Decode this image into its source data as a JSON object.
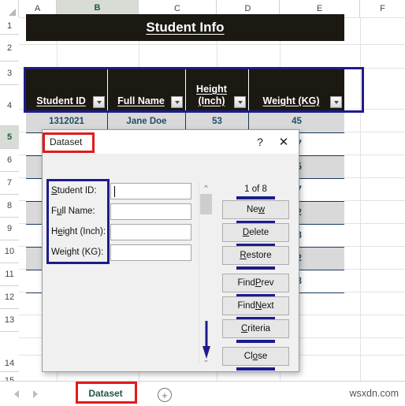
{
  "spreadsheet": {
    "column_headers": [
      "A",
      "B",
      "C",
      "D",
      "E",
      "F"
    ],
    "selected_column": "B",
    "row_headers": [
      "1",
      "2",
      "3",
      "4",
      "5",
      "6",
      "7",
      "8",
      "9",
      "10",
      "11",
      "12",
      "13",
      "14",
      "15"
    ],
    "selected_row": "5",
    "title_banner": "Student Info",
    "table_headers": [
      "Student ID",
      "Full Name",
      "Height (Inch)",
      "Weight (KG)"
    ],
    "filter_icon": "chevron-down-icon",
    "rows": [
      {
        "student_id": "1312021",
        "full_name": "Jane Doe",
        "height": "53",
        "weight": "45"
      },
      {
        "student_id": "",
        "full_name": "",
        "height": "",
        "weight": "47"
      },
      {
        "student_id": "",
        "full_name": "",
        "height": "",
        "weight": "65"
      },
      {
        "student_id": "",
        "full_name": "",
        "height": "",
        "weight": "67"
      },
      {
        "student_id": "",
        "full_name": "",
        "height": "",
        "weight": "52"
      },
      {
        "student_id": "",
        "full_name": "",
        "height": "",
        "weight": "58"
      },
      {
        "student_id": "",
        "full_name": "",
        "height": "",
        "weight": "72"
      },
      {
        "student_id": "",
        "full_name": "",
        "height": "",
        "weight": "58"
      }
    ]
  },
  "dialog": {
    "title": "Dataset",
    "help_label": "?",
    "close_label": "✕",
    "record_indicator": "1 of 8",
    "fields": [
      {
        "label_pre": "",
        "label_key": "S",
        "label_post": "tudent ID:",
        "value": "",
        "focused": true
      },
      {
        "label_pre": "F",
        "label_key": "u",
        "label_post": "ll Name:",
        "value": "",
        "focused": false
      },
      {
        "label_pre": "H",
        "label_key": "e",
        "label_post": "ight (Inch):",
        "value": "",
        "focused": false
      },
      {
        "label_pre": "Wei",
        "label_key": "g",
        "label_post": "ht (KG):",
        "value": "",
        "focused": false
      }
    ],
    "buttons": [
      {
        "pre": "Ne",
        "key": "w",
        "post": ""
      },
      {
        "pre": "",
        "key": "D",
        "post": "elete"
      },
      {
        "pre": "",
        "key": "R",
        "post": "estore"
      },
      {
        "pre": "Find ",
        "key": "P",
        "post": "rev"
      },
      {
        "pre": "Find ",
        "key": "N",
        "post": "ext"
      },
      {
        "pre": "",
        "key": "C",
        "post": "riteria"
      },
      {
        "pre": "Cl",
        "key": "o",
        "post": "se"
      }
    ],
    "scrollbar": {
      "up_arrow": "chevron-up-icon",
      "down_arrow": "chevron-down-icon"
    }
  },
  "tabbar": {
    "prev_sheet_icon": "triangle-left-icon",
    "next_sheet_icon": "triangle-right-icon",
    "sheet_name": "Dataset",
    "add_sheet_label": "+",
    "watermark": "wsxdn.com"
  },
  "colors": {
    "header_fill": "#1c1812",
    "annotation_blue": "#1c1c8c",
    "annotation_red": "#e01b1b",
    "data_text": "#1f4e66",
    "tab_green": "#21573f"
  }
}
